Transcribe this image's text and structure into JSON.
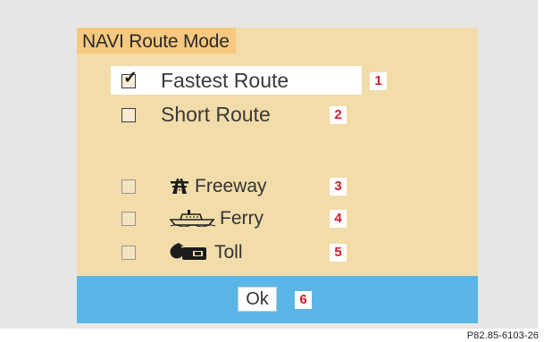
{
  "dialog": {
    "title": "NAVI Route Mode",
    "route_options": [
      {
        "label": "Fastest Route",
        "checked": true,
        "badge": "1"
      },
      {
        "label": "Short Route",
        "checked": false,
        "badge": "2"
      }
    ],
    "avoid_options": [
      {
        "label": "Freeway",
        "checked": false,
        "badge": "3",
        "icon": "freeway-icon"
      },
      {
        "label": "Ferry",
        "checked": false,
        "badge": "4",
        "icon": "ferry-icon"
      },
      {
        "label": "Toll",
        "checked": false,
        "badge": "5",
        "icon": "toll-icon"
      }
    ],
    "ok_label": "Ok",
    "ok_badge": "6"
  },
  "reference_code": "P82.85-6103-26",
  "colors": {
    "panel_bg": "#f2dcaa",
    "title_bg": "#f7c980",
    "footer_bg": "#5ab6e6",
    "badge_text": "#cc1c2b",
    "frame_bg": "#e6e6e6"
  }
}
